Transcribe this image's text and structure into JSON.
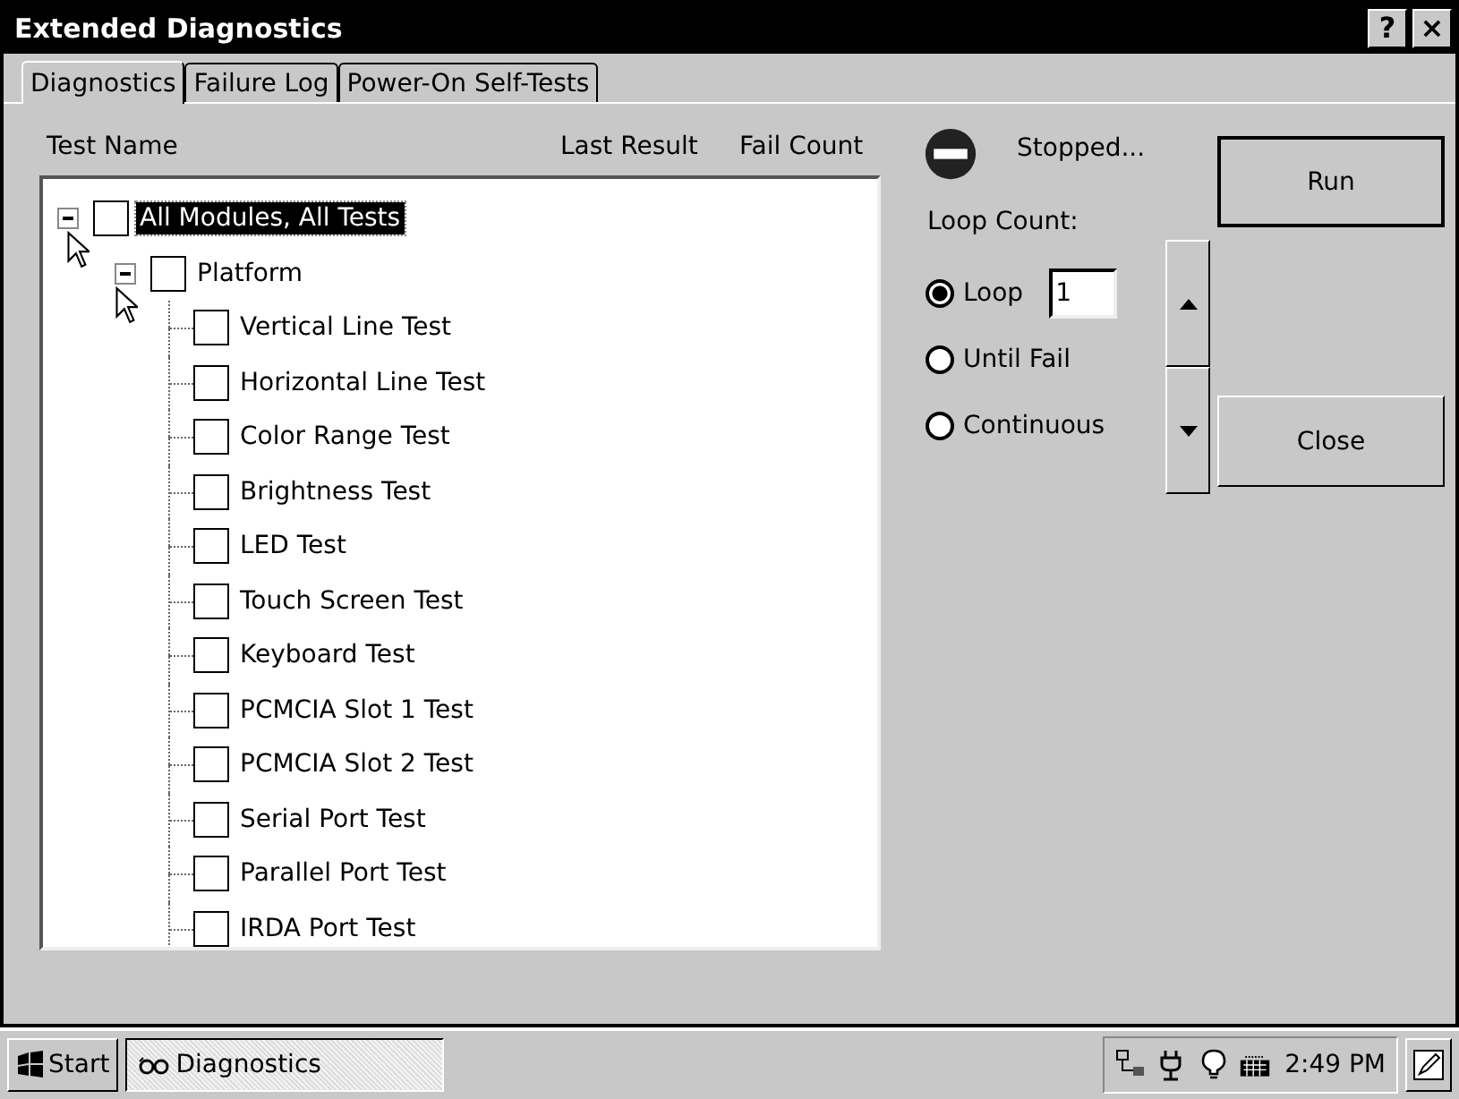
{
  "window": {
    "title": "Extended Diagnostics",
    "title_buttons": [
      "?",
      "×"
    ]
  },
  "tabs": [
    {
      "label": "Diagnostics",
      "selected": true
    },
    {
      "label": "Failure Log",
      "selected": false
    },
    {
      "label": "Power-On Self-Tests",
      "selected": false
    }
  ],
  "columns": [
    "Test Name",
    "Last Result",
    "Fail Count"
  ],
  "tree": [
    {
      "label": "All Modules, All Tests",
      "checked": false,
      "selected": true,
      "expanded": true,
      "children": [
        {
          "label": "Platform",
          "checked": false,
          "selected": false,
          "expanded": true,
          "children": [
            {
              "label": "Vertical Line Test",
              "checked": false,
              "selected": false
            },
            {
              "label": "Horizontal Line Test",
              "checked": false,
              "selected": false
            },
            {
              "label": "Color Range Test",
              "checked": false,
              "selected": false
            },
            {
              "label": "Brightness Test",
              "checked": false,
              "selected": false
            },
            {
              "label": "LED Test",
              "checked": false,
              "selected": false
            },
            {
              "label": "Touch Screen Test",
              "checked": false,
              "selected": false
            },
            {
              "label": "Keyboard Test",
              "checked": false,
              "selected": false
            },
            {
              "label": "PCMCIA Slot 1 Test",
              "checked": false,
              "selected": false
            },
            {
              "label": "PCMCIA Slot 2 Test",
              "checked": false,
              "selected": false
            },
            {
              "label": "Serial Port Test",
              "checked": false,
              "selected": false
            },
            {
              "label": "Parallel Port Test",
              "checked": false,
              "selected": false
            },
            {
              "label": "IRDA Port Test",
              "checked": false,
              "selected": false
            }
          ]
        }
      ]
    }
  ],
  "status": {
    "text": "Stopped..."
  },
  "loop_count": {
    "label": "Loop Count:",
    "value": "1",
    "options": [
      {
        "label": "Loop",
        "selected": true
      },
      {
        "label": "Until Fail",
        "selected": false
      },
      {
        "label": "Continuous",
        "selected": false
      }
    ]
  },
  "buttons": [
    "Run",
    "Close"
  ],
  "taskbar": {
    "start": "Start",
    "tasks": [
      {
        "label": "Diagnostics",
        "selected": true
      }
    ],
    "clock": "2:49 PM"
  }
}
